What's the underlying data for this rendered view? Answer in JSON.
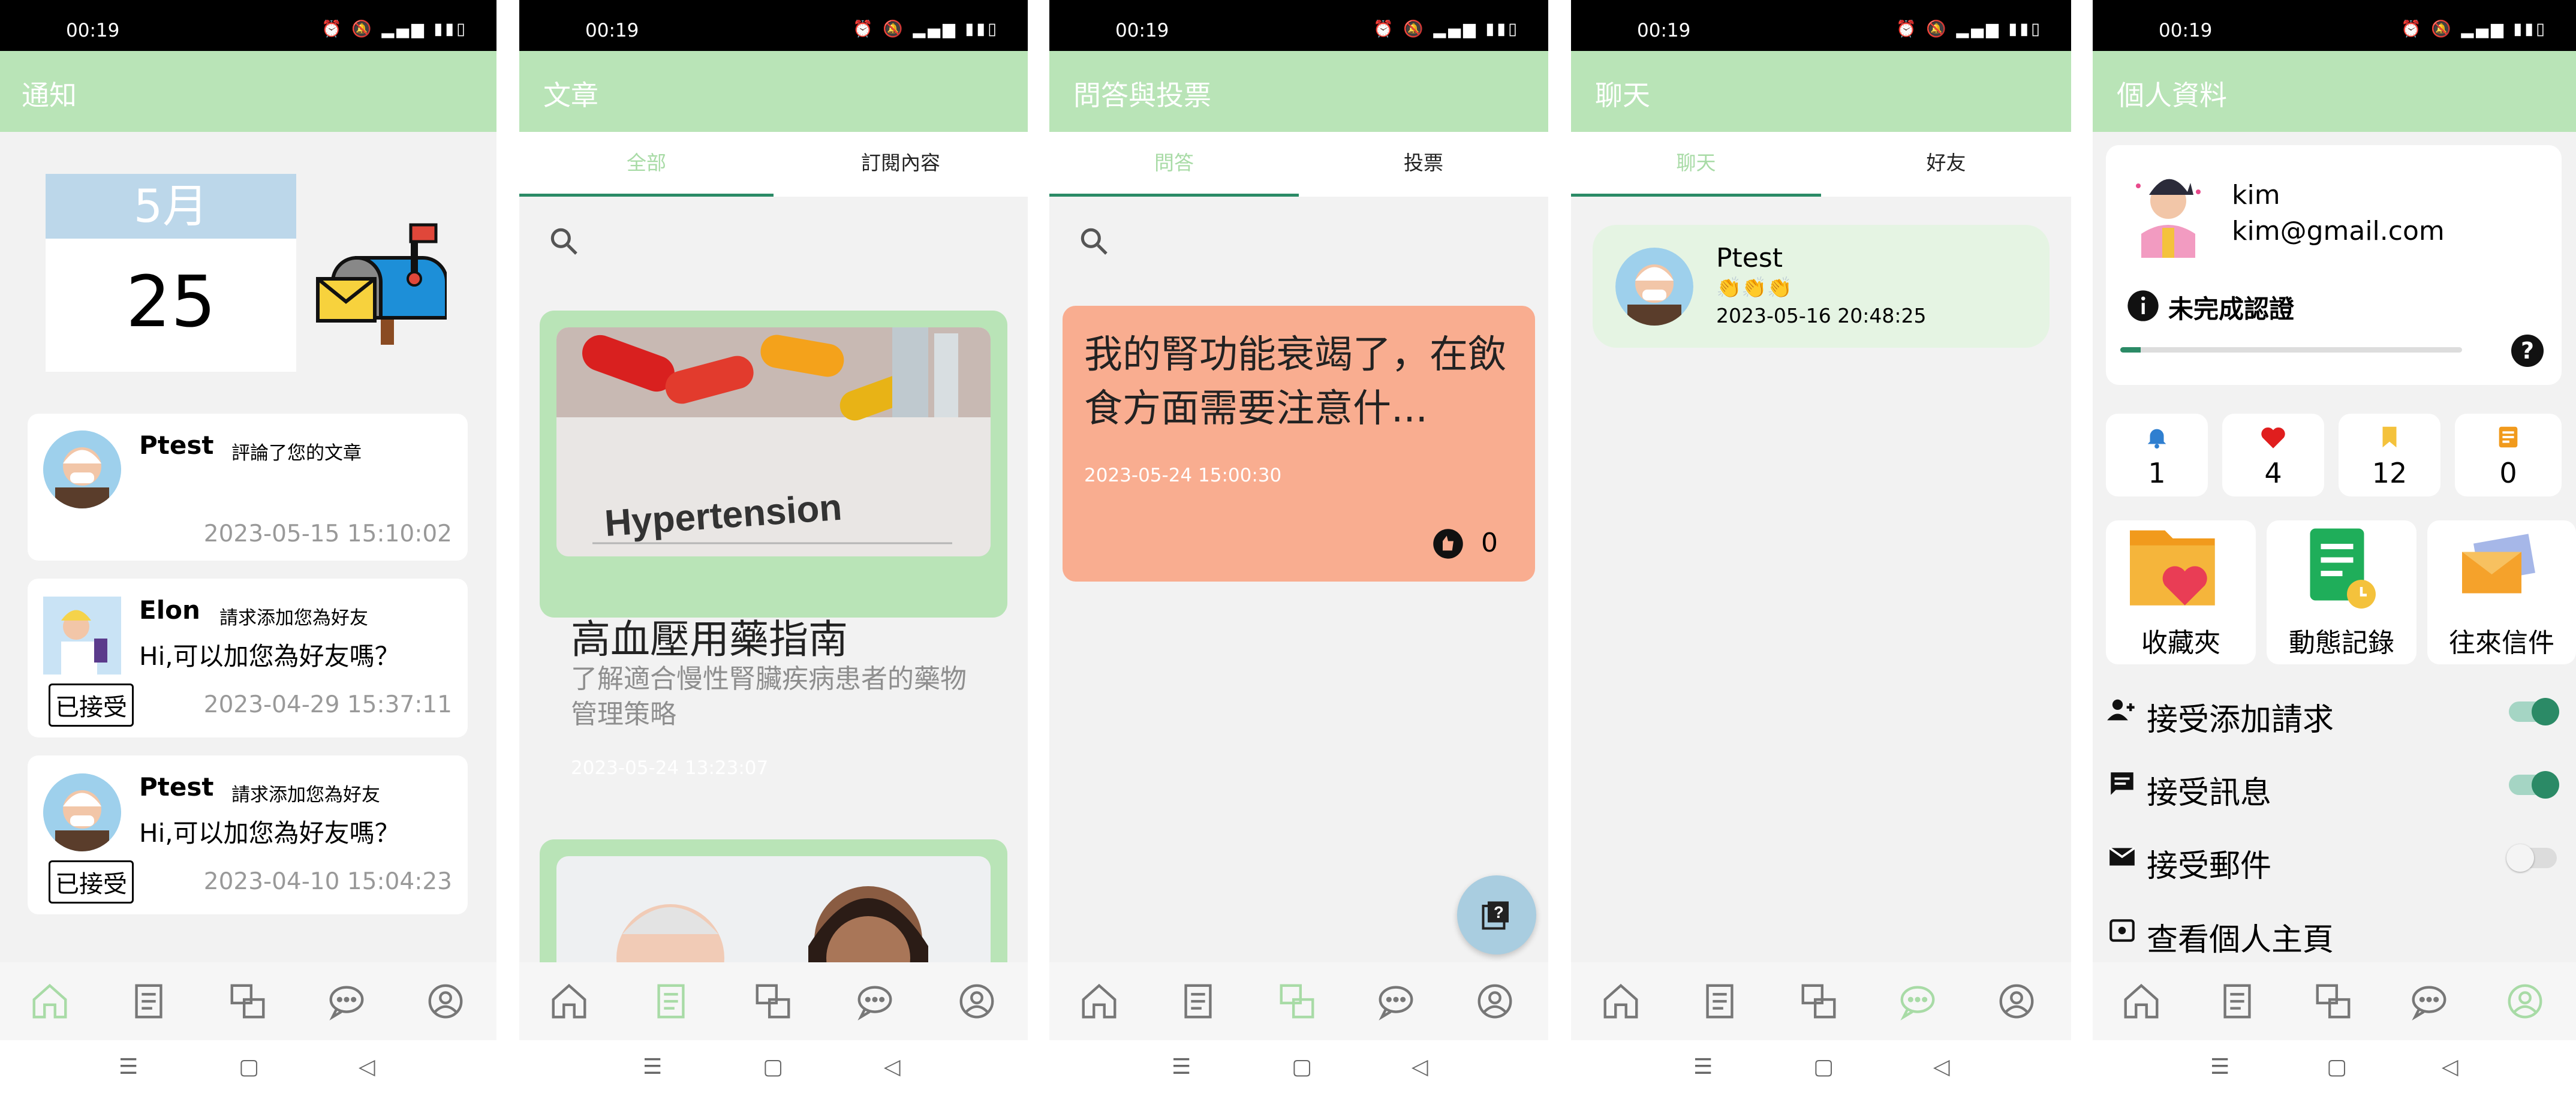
{
  "status": {
    "time": "00:19"
  },
  "notifications": {
    "title": "通知",
    "calendar": {
      "month": "5月",
      "day": "25"
    },
    "items": [
      {
        "name": "Ptest",
        "action": "評論了您的文章",
        "message": "",
        "time": "2023-05-15 15:10:02",
        "badge": ""
      },
      {
        "name": "Elon",
        "action": "請求添加您為好友",
        "message": "Hi,可以加您為好友嗎？",
        "time": "2023-04-29 15:37:11",
        "badge": "已接受"
      },
      {
        "name": "Ptest",
        "action": "請求添加您為好友",
        "message": "Hi,可以加您為好友嗎？",
        "time": "2023-04-10 15:04:23",
        "badge": "已接受"
      }
    ]
  },
  "articles": {
    "title": "文章",
    "tabs": [
      "全部",
      "訂閱內容"
    ],
    "card": {
      "image_text": "Hypertension",
      "title": "高血壓用藥指南",
      "desc": "了解適合慢性腎臟疾病患者的藥物管理策略",
      "time": "2023-05-24 13:23:07"
    }
  },
  "qa": {
    "title": "問答與投票",
    "tabs": [
      "問答",
      "投票"
    ],
    "card": {
      "question": "我的腎功能衰竭了，在飲食方面需要注意什...",
      "time": "2023-05-24 15:00:30",
      "likes": "0"
    }
  },
  "chat": {
    "title": "聊天",
    "tabs": [
      "聊天",
      "好友"
    ],
    "item": {
      "name": "Ptest",
      "emoji": "👏👏👏",
      "time": "2023-05-16 20:48:25"
    }
  },
  "profile": {
    "title": "個人資料",
    "name": "kim",
    "email": "kim@gmail.com",
    "verify": "未完成認證",
    "verify_progress": 0.06,
    "help": "?",
    "stats": [
      {
        "icon": "bell-icon",
        "value": "1",
        "color": "#2f7fd0"
      },
      {
        "icon": "heart-icon",
        "value": "4",
        "color": "#e01e1e"
      },
      {
        "icon": "bookmark-icon",
        "value": "12",
        "color": "#f4c23c"
      },
      {
        "icon": "note-icon",
        "value": "0",
        "color": "#f19a1c"
      }
    ],
    "shortcuts": [
      "收藏夾",
      "動態記錄",
      "往來信件"
    ],
    "settings": [
      {
        "label": "接受添加請求",
        "on": true
      },
      {
        "label": "接受訊息",
        "on": true
      },
      {
        "label": "接受郵件",
        "on": false
      },
      {
        "label": "查看個人主頁"
      }
    ]
  },
  "colors": {
    "appbar": "#b9e4b7",
    "accent": "#2b8a66",
    "card_green": "#b9e4b7",
    "card_salmon": "#f9ad90",
    "chat_card": "#e5f4e3"
  }
}
